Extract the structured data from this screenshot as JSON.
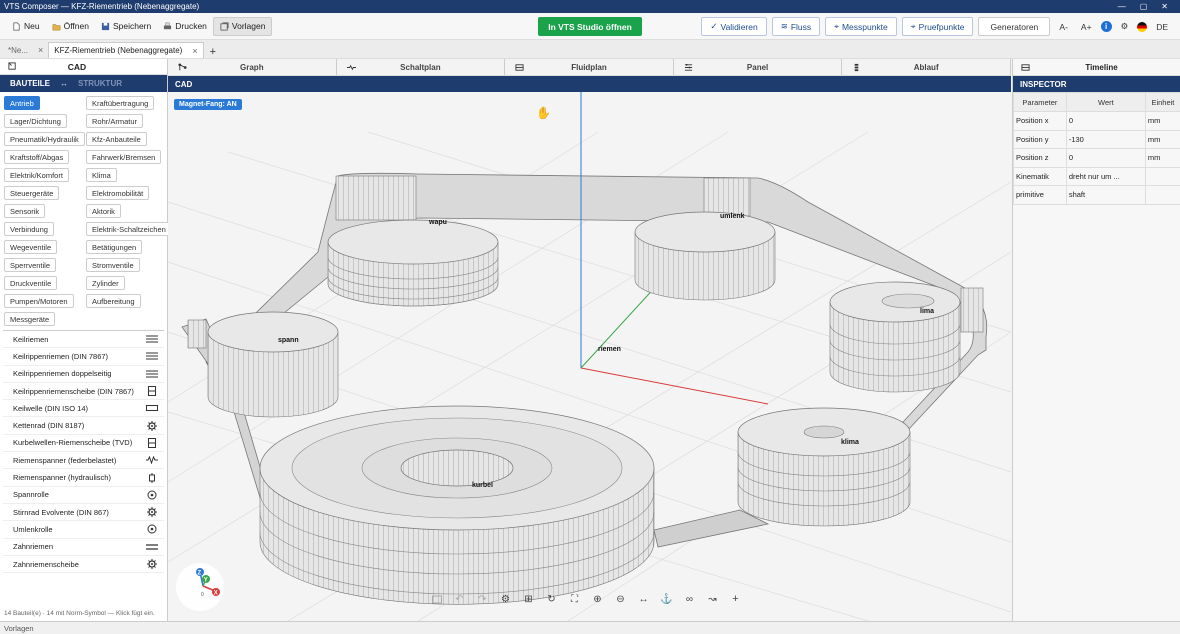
{
  "window": {
    "title": "VTS Composer — KFZ-Riementrieb (Nebenaggregate)"
  },
  "toolbar": {
    "new_label": "Neu",
    "open_label": "Öffnen",
    "save_label": "Speichern",
    "print_label": "Drucken",
    "templates_label": "Vorlagen",
    "studio_label": "In VTS Studio öffnen",
    "validate_label": "Validieren",
    "flow_label": "Fluss",
    "measure_label": "Messpunkte",
    "check_label": "Pruefpunkte",
    "generators_label": "Generatoren",
    "font_smaller": "A-",
    "font_larger": "A+",
    "info_glyph": "i",
    "lang_label": "DE"
  },
  "doc_tabs": [
    {
      "label": "*Ne...",
      "close": "×"
    },
    {
      "label": "KFZ-Riementrieb (Nebenaggregate)",
      "close": "×"
    }
  ],
  "add_tab": "+",
  "left": {
    "header": "CAD",
    "tab_parts": "BAUTEILE",
    "tab_sep": "↔",
    "tab_structure": "STRUKTUR",
    "categories": [
      "Antrieb",
      "Kraftübertragung",
      "Lager/Dichtung",
      "Rohr/Armatur",
      "Pneumatik/Hydraulik",
      "Kfz-Anbauteile",
      "Kraftstoff/Abgas",
      "Fahrwerk/Bremsen",
      "Elektrik/Komfort",
      "Klima",
      "Steuergeräte",
      "Elektromobilität",
      "Sensorik",
      "Aktorik",
      "Verbindung",
      "Elektrik-Schaltzeichen",
      "Wegeventile",
      "Betätigungen",
      "Sperrventile",
      "Stromventile",
      "Druckventile",
      "Zylinder",
      "Pumpen/Motoren",
      "Aufbereitung",
      "Messgeräte"
    ],
    "parts": [
      {
        "name": "Keilriemen",
        "icon": "triple-line-icon"
      },
      {
        "name": "Keilrippenriemen (DIN 7867)",
        "icon": "triple-line-icon"
      },
      {
        "name": "Keilrippenriemen doppelseitig",
        "icon": "triple-line-icon"
      },
      {
        "name": "Keilrippenriemenscheibe (DIN 7867)",
        "icon": "pulley-icon"
      },
      {
        "name": "Keilwelle (DIN ISO 14)",
        "icon": "shaft-icon"
      },
      {
        "name": "Kettenrad (DIN 8187)",
        "icon": "gear-icon"
      },
      {
        "name": "Kurbelwellen-Riemenscheibe (TVD)",
        "icon": "pulley-icon"
      },
      {
        "name": "Riemenspanner (federbelastet)",
        "icon": "spring-icon"
      },
      {
        "name": "Riemenspanner (hydraulisch)",
        "icon": "hydraulic-icon"
      },
      {
        "name": "Spannrolle",
        "icon": "roller-icon"
      },
      {
        "name": "Stirnrad Evolvente (DIN 867)",
        "icon": "gear-icon"
      },
      {
        "name": "Umlenkrolle",
        "icon": "roller-icon"
      },
      {
        "name": "Zahnriemen",
        "icon": "double-line-icon"
      },
      {
        "name": "Zahnriemenscheibe",
        "icon": "gear-icon"
      }
    ],
    "footer": "14 Bauteil(e) · 14 mit Norm-Symbol — Klick fügt ein."
  },
  "view_tabs": [
    "Graph",
    "Schaltplan",
    "Fluidplan",
    "Panel",
    "Ablauf"
  ],
  "cad_title": "CAD",
  "viewport": {
    "magnet_label": "Magnet-Fang: AN",
    "labels": {
      "wapu": "wapu",
      "umlenk": "umlenk",
      "lima": "lima",
      "spann": "spann",
      "riemen": "riemen",
      "klima": "klima",
      "kurbel": "kurbel"
    },
    "axis": {
      "z": "Z",
      "y": "Y",
      "x": "X",
      "o": "0"
    },
    "axis_colors": {
      "x": "#d93b3b",
      "y": "#3aa64a",
      "z": "#2a7ad6"
    }
  },
  "inspector": {
    "tab_label": "Timeline",
    "header": "INSPECTOR",
    "columns": [
      "Parameter",
      "Wert",
      "Einheit"
    ],
    "rows": [
      [
        "Position x",
        "0",
        "mm"
      ],
      [
        "Position y",
        "-130",
        "mm"
      ],
      [
        "Position z",
        "0",
        "mm"
      ],
      [
        "Kinematik",
        "dreht nur um ...",
        ""
      ],
      [
        "primitive",
        "shaft",
        ""
      ]
    ]
  },
  "status": "Vorlagen",
  "colors": {
    "accent": "#1f3c6e",
    "primary": "#2a7ad6",
    "success": "#1aa34a"
  }
}
